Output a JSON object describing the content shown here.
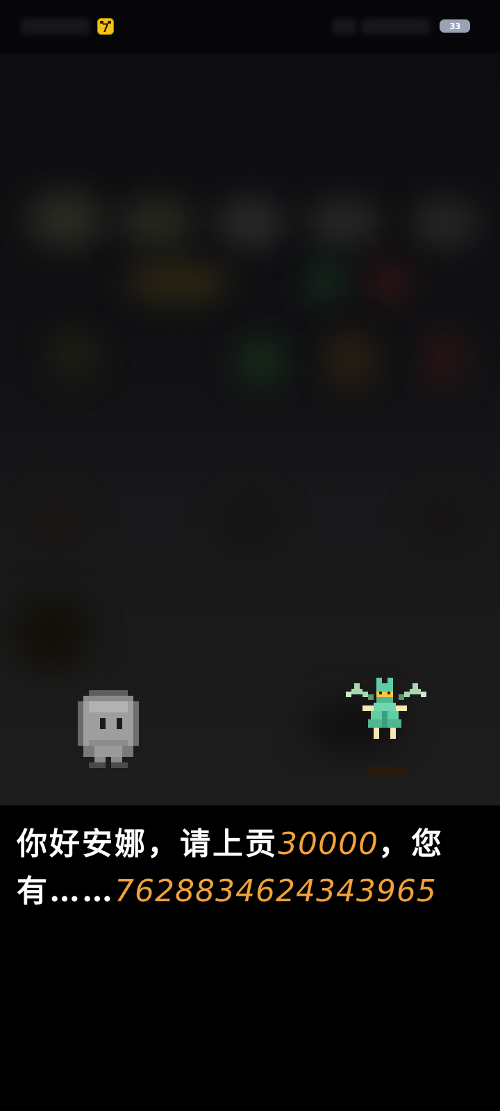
{
  "status_bar": {
    "app_icon_glyph": "7",
    "battery_level": "33"
  },
  "scene": {
    "characters": [
      {
        "name": "pale-ghost-sprite",
        "color": "#9a9a9a"
      },
      {
        "name": "green-fairy-sprite",
        "color": "#5fcfa3"
      }
    ]
  },
  "dialog": {
    "part1": "你好安娜，请上贡",
    "tribute_amount": "30000",
    "part2": "，您有……",
    "owned_amount": "7628834624343965"
  },
  "colors": {
    "dialog_text": "#ffffff",
    "highlight_number": "#f1a13a",
    "scene_background": "#141416",
    "app_icon": "#f3c215"
  }
}
